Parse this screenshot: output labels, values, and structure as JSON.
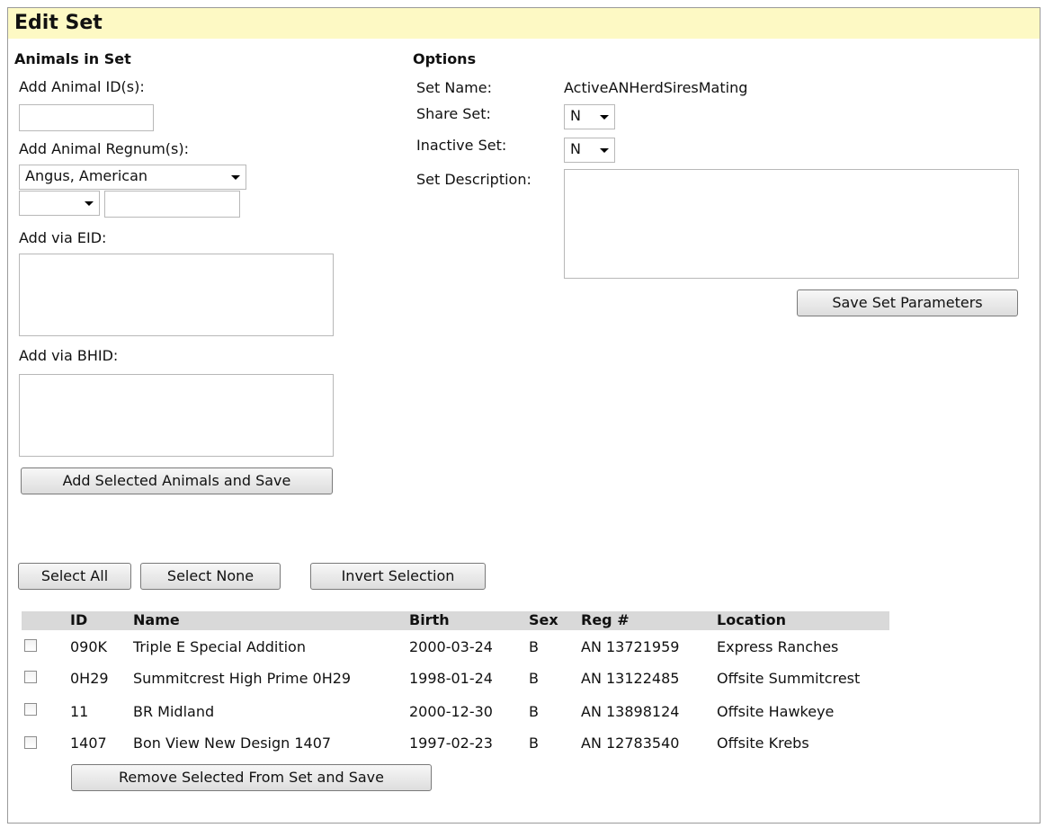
{
  "page": {
    "title": "Edit Set"
  },
  "animals_section": {
    "heading": "Animals in Set",
    "add_id_label": "Add Animal ID(s):",
    "add_id_value": "",
    "add_regnum_label": "Add Animal Regnum(s):",
    "breed_selected": "Angus, American",
    "prefix_selected": "",
    "regnum_value": "",
    "eid_label": "Add via EID:",
    "eid_value": "",
    "bhid_label": "Add via BHID:",
    "bhid_value": "",
    "add_button": "Add Selected Animals and Save"
  },
  "options_section": {
    "heading": "Options",
    "set_name_label": "Set Name:",
    "set_name_value": "ActiveANHerdSiresMating",
    "share_label": "Share Set:",
    "share_value": "N",
    "inactive_label": "Inactive Set:",
    "inactive_value": "N",
    "description_label": "Set Description:",
    "description_value": "",
    "save_button": "Save Set Parameters"
  },
  "selection_buttons": {
    "select_all": "Select All",
    "select_none": "Select None",
    "invert": "Invert Selection"
  },
  "table": {
    "columns": [
      "ID",
      "Name",
      "Birth",
      "Sex",
      "Reg #",
      "Location"
    ],
    "rows": [
      {
        "id": "090K",
        "name": "Triple E Special Addition",
        "birth": "2000-03-24",
        "sex": "B",
        "reg": "AN 13721959",
        "location": "Express Ranches",
        "checked": false
      },
      {
        "id": "0H29",
        "name": "Summitcrest High Prime 0H29",
        "birth": "1998-01-24",
        "sex": "B",
        "reg": "AN 13122485",
        "location": "Offsite Summitcrest",
        "checked": false
      },
      {
        "id": "11",
        "name": "BR Midland",
        "birth": "2000-12-30",
        "sex": "B",
        "reg": "AN 13898124",
        "location": "Offsite Hawkeye",
        "checked": false
      },
      {
        "id": "1407",
        "name": "Bon View New Design 1407",
        "birth": "1997-02-23",
        "sex": "B",
        "reg": "AN 12783540",
        "location": "Offsite Krebs",
        "checked": false
      }
    ],
    "remove_button": "Remove Selected From Set and Save"
  }
}
